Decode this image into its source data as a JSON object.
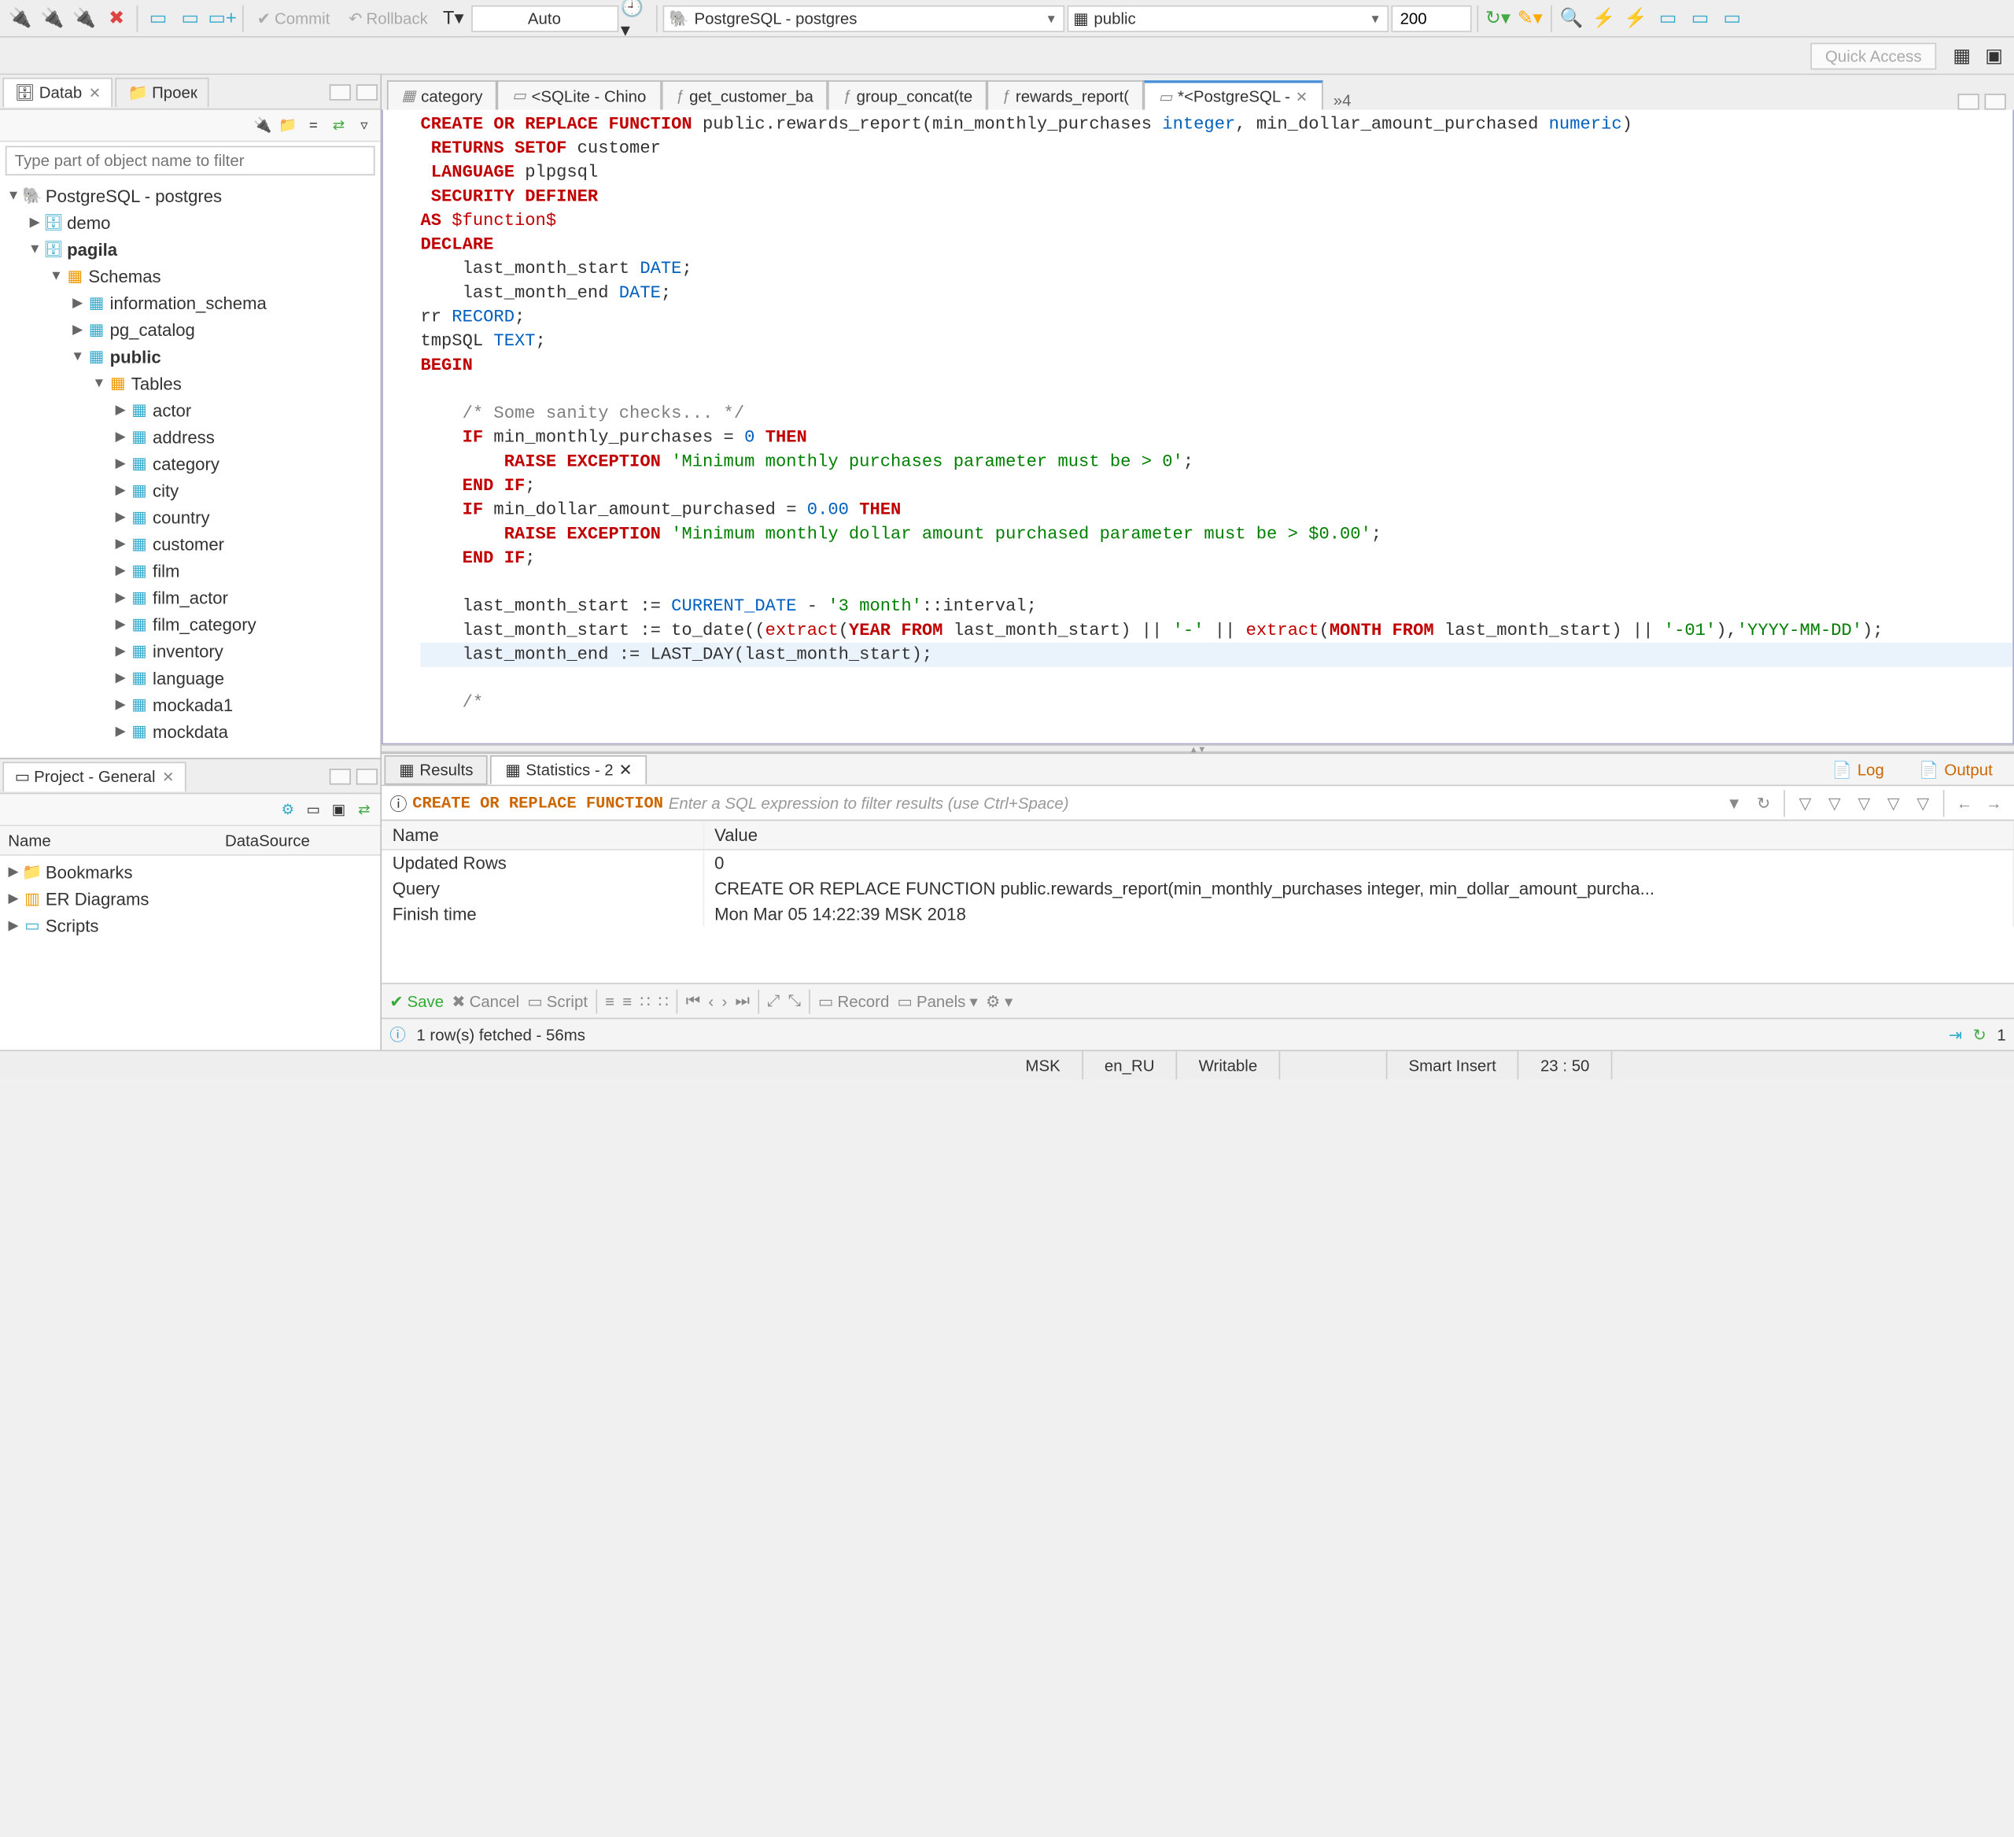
{
  "toolbar": {
    "commit_label": "Commit",
    "rollback_label": "Rollback",
    "auto_label": "Auto",
    "connection": "PostgreSQL - postgres",
    "schema": "public",
    "limit": "200",
    "quick_access": "Quick Access"
  },
  "left_tabs": {
    "databases": "Datab",
    "projects": "Проек"
  },
  "filter_placeholder": "Type part of object name to filter",
  "tree": {
    "root": "PostgreSQL - postgres",
    "demo": "demo",
    "pagila": "pagila",
    "schemas": "Schemas",
    "info_schema": "information_schema",
    "pg_catalog": "pg_catalog",
    "public": "public",
    "tables": "Tables",
    "t_actor": "actor",
    "t_address": "address",
    "t_category": "category",
    "t_city": "city",
    "t_country": "country",
    "t_customer": "customer",
    "t_film": "film",
    "t_film_actor": "film_actor",
    "t_film_category": "film_category",
    "t_inventory": "inventory",
    "t_language": "language",
    "t_mockada1": "mockada1",
    "t_mockdata": "mockdata"
  },
  "project_panel": {
    "title": "Project - General",
    "col_name": "Name",
    "col_datasource": "DataSource",
    "bookmarks": "Bookmarks",
    "er": "ER Diagrams",
    "scripts": "Scripts"
  },
  "editor_tabs": {
    "t1": "category",
    "t2": "<SQLite - Chino",
    "t3": "get_customer_ba",
    "t4": "group_concat(te",
    "t5": "rewards_report(",
    "t6": "*<PostgreSQL - ",
    "more": "»4"
  },
  "code": {
    "l1a": "CREATE OR REPLACE FUNCTION",
    "l1b": " public.rewards_report(min_monthly_purchases",
    "l1c": " integer",
    "l1d": ", min_dollar_amount_purchased",
    "l1e": " numeric",
    "l1f": ")",
    "l2a": " RETURNS SETOF",
    "l2b": " customer",
    "l3a": " LANGUAGE",
    "l3b": " plpgsql",
    "l4": " SECURITY DEFINER",
    "l5a": "AS ",
    "l5b": "$function$",
    "l6": "DECLARE",
    "l7a": "    last_month_start ",
    "l7b": "DATE",
    "l7c": ";",
    "l8a": "    last_month_end ",
    "l8b": "DATE",
    "l8c": ";",
    "l9a": "rr ",
    "l9b": "RECORD",
    "l9c": ";",
    "l10a": "tmpSQL ",
    "l10b": "TEXT",
    "l10c": ";",
    "l11": "BEGIN",
    "l12": "",
    "l13": "    /* Some sanity checks... */",
    "l14a": "    IF",
    "l14b": " min_monthly_purchases = ",
    "l14c": "0",
    "l14d": " THEN",
    "l15a": "        RAISE EXCEPTION ",
    "l15b": "'Minimum monthly purchases parameter must be > 0'",
    "l15c": ";",
    "l16a": "    END",
    "l16b": " IF",
    "l16c": ";",
    "l17a": "    IF",
    "l17b": " min_dollar_amount_purchased = ",
    "l17c": "0.00",
    "l17d": " THEN",
    "l18a": "        RAISE EXCEPTION ",
    "l18b": "'Minimum monthly dollar amount purchased parameter must be > $0.00'",
    "l18c": ";",
    "l19a": "    END",
    "l19b": " IF",
    "l19c": ";",
    "l20": "",
    "l21a": "    last_month_start := ",
    "l21b": "CURRENT_DATE",
    "l21c": " - ",
    "l21d": "'3 month'",
    "l21e": "::interval;",
    "l22a": "    last_month_start := to_date((",
    "l22b": "extract",
    "l22c": "(",
    "l22d": "YEAR FROM",
    "l22e": " last_month_start) || ",
    "l22f": "'-'",
    "l22g": " || ",
    "l22h": "extract",
    "l22i": "(",
    "l22j": "MONTH FROM",
    "l22k": " last_month_start) || ",
    "l22l": "'-01'",
    "l22m": "),",
    "l22n": "'YYYY-MM-DD'",
    "l22o": ");",
    "l23a": "    last_month_end := LAST_DAY(last_month_start);",
    "l24": "",
    "l25": "    /*"
  },
  "results": {
    "tab_results": "Results",
    "tab_statistics": "Statistics - 2",
    "log": "Log",
    "output": "Output",
    "sql_tok": "CREATE OR REPLACE FUNCTION",
    "filter_hint": "Enter a SQL expression to filter results (use Ctrl+Space)",
    "col_name": "Name",
    "col_value": "Value",
    "r1_name": "Updated Rows",
    "r1_val": "0",
    "r2_name": "Query",
    "r2_val": "CREATE OR REPLACE FUNCTION public.rewards_report(min_monthly_purchases integer, min_dollar_amount_purcha...",
    "r3_name": "Finish time",
    "r3_val": "Mon Mar 05 14:22:39 MSK 2018",
    "save": "Save",
    "cancel": "Cancel",
    "script": "Script",
    "record": "Record",
    "panels": "Panels",
    "status": "1 row(s) fetched - 56ms",
    "refresh_count": "1"
  },
  "statusbar": {
    "tz": "MSK",
    "locale": "en_RU",
    "writable": "Writable",
    "insert": "Smart Insert",
    "pos": "23 : 50"
  }
}
